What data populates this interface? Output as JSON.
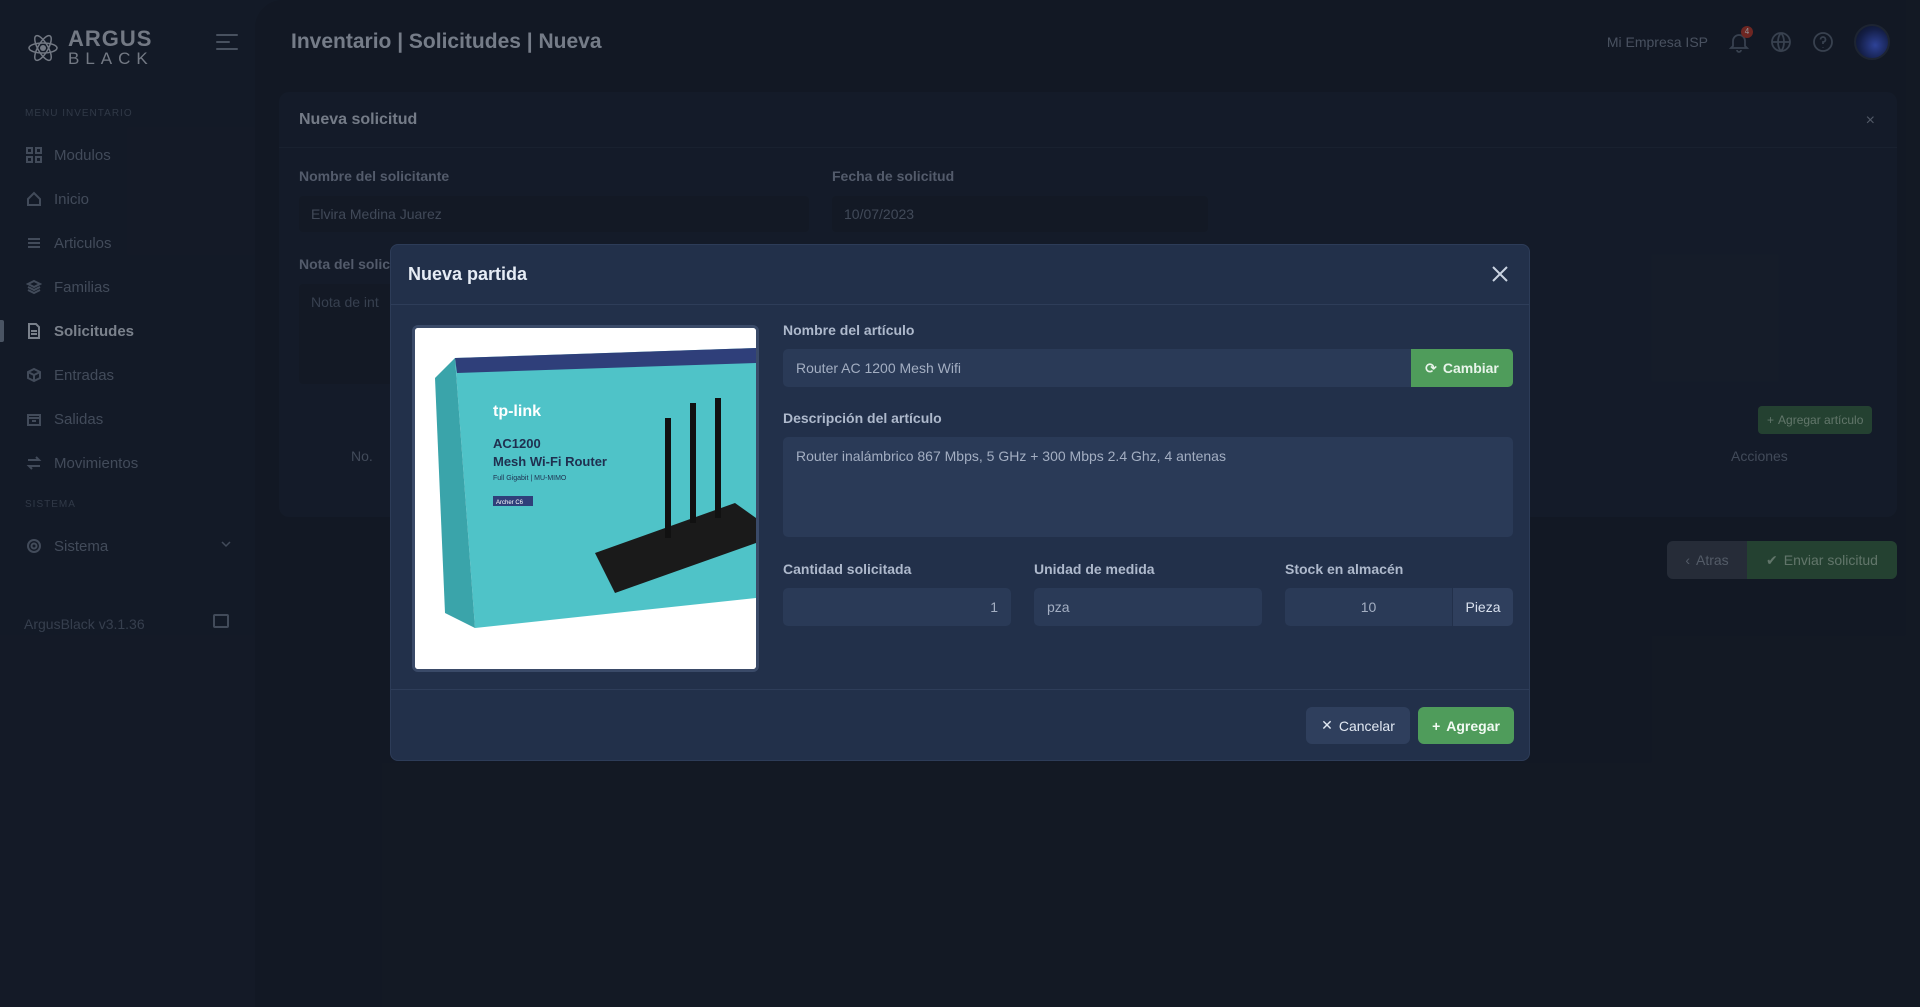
{
  "sidebar": {
    "logo_line1": "ARGUS",
    "logo_line2": "BLACK",
    "section_inventory": "MENU INVENTARIO",
    "section_system": "SISTEMA",
    "items": [
      {
        "label": "Modulos",
        "icon": "grid-icon"
      },
      {
        "label": "Inicio",
        "icon": "home-icon"
      },
      {
        "label": "Articulos",
        "icon": "list-icon"
      },
      {
        "label": "Familias",
        "icon": "layers-icon"
      },
      {
        "label": "Solicitudes",
        "icon": "file-icon",
        "active": true
      },
      {
        "label": "Entradas",
        "icon": "box-in-icon"
      },
      {
        "label": "Salidas",
        "icon": "box-out-icon"
      },
      {
        "label": "Movimientos",
        "icon": "transfer-icon"
      }
    ],
    "system_item": "Sistema",
    "version": "ArgusBlack v3.1.36"
  },
  "header": {
    "title": "Inventario | Solicitudes | Nueva",
    "company": "Mi Empresa ISP",
    "notification_count": "4"
  },
  "card": {
    "title": "Nueva solicitud",
    "close": "×",
    "requester_label": "Nombre del solicitante",
    "requester_value": "Elvira Medina Juarez",
    "date_label": "Fecha de solicitud",
    "date_value": "10/07/2023",
    "note_label": "Nota del solic",
    "note_placeholder": "Nota de int",
    "add_article": "Agregar artículo",
    "col_no": "No.",
    "col_actions": "Acciones"
  },
  "actions": {
    "back": "Atras",
    "send": "Enviar solicitud"
  },
  "modal": {
    "title": "Nueva partida",
    "article_name_label": "Nombre del artículo",
    "article_name_value": "Router AC 1200 Mesh Wifi",
    "change_button": "Cambiar",
    "description_label": "Descripción del artículo",
    "description_value": "Router inalámbrico 867 Mbps, 5 GHz + 300 Mbps 2.4 Ghz, 4 antenas",
    "qty_label": "Cantidad solicitada",
    "qty_value": "1",
    "unit_label": "Unidad de medida",
    "unit_value": "pza",
    "stock_label": "Stock en almacén",
    "stock_value": "10",
    "stock_unit": "Pieza",
    "cancel_button": "Cancelar",
    "add_button": "Agregar",
    "product_image": {
      "brand": "tp-link",
      "model": "AC1200",
      "name_line1": "Mesh Wi-Fi Router",
      "name_line2": "Full Gigabit | MU-MIMO",
      "series": "Archer C6"
    }
  }
}
